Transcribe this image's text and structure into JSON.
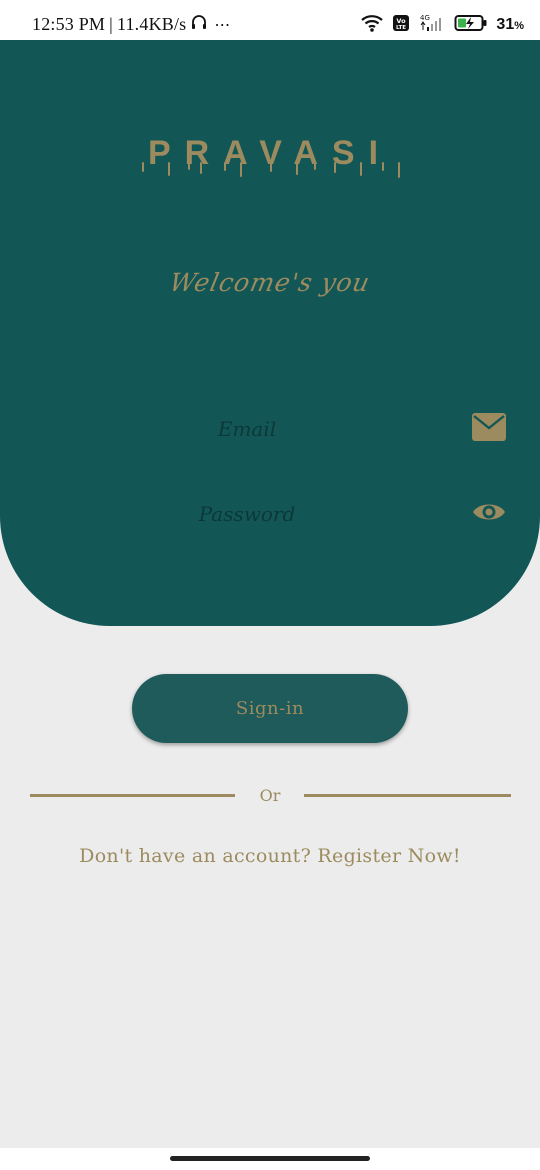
{
  "status_bar": {
    "time": "12:53 PM",
    "separator": "|",
    "speed": "11.4KB/s",
    "more": "⋯",
    "network_type": "4G",
    "volte": "Vo LTE",
    "battery_percent": "31",
    "battery_unit": "%"
  },
  "app": {
    "logo_text": "PRAVASI",
    "tagline": "Welcome's you"
  },
  "form": {
    "email_placeholder": "Email",
    "password_placeholder": "Password",
    "signin_label": "Sign-in",
    "divider_label": "Or",
    "register_prompt": "Don't have an account? Register Now!"
  },
  "icons": {
    "email": "mail-icon",
    "password_toggle": "eye-icon"
  },
  "colors": {
    "primary": "#135656",
    "accent": "#9c8b5e",
    "button": "#1f5b5b",
    "background": "#ececec"
  }
}
